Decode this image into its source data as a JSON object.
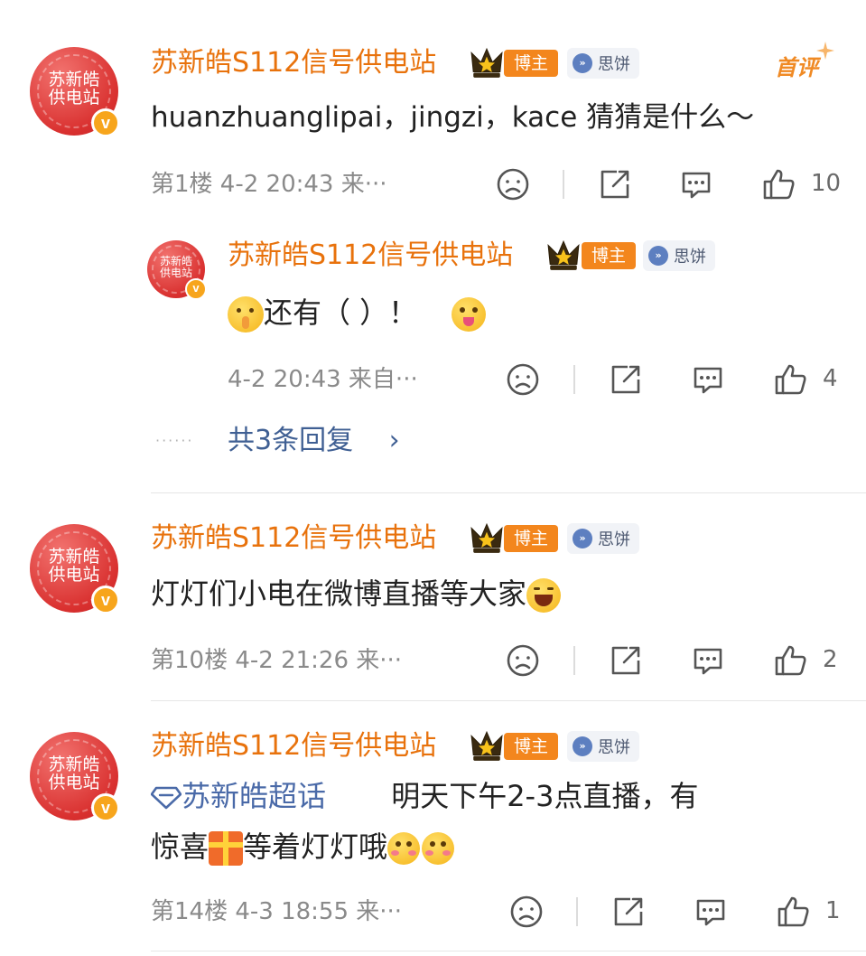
{
  "colors": {
    "username": "#e8720c",
    "bozhu_badge": "#f3861d",
    "link": "#3f5f93",
    "meta": "#8a8a8a"
  },
  "comments": [
    {
      "avatar_text": "苏新皓供电站",
      "username": "苏新皓S112信号供电站",
      "badge": "博主",
      "tag": "思饼",
      "hot_label": "首评",
      "text": "huanzhuanglipai，jingzi，kace 猜猜是什么～",
      "meta": "第1楼 4-2 20:43 来···",
      "likes": "10",
      "reply": {
        "avatar_text": "苏新皓供电站",
        "username": "苏新皓S112信号供电站",
        "badge": "博主",
        "tag": "思饼",
        "text": "还有（ ）！",
        "meta": "4-2 20:43 来自···",
        "likes": "4"
      },
      "more_replies": "共3条回复"
    },
    {
      "avatar_text": "苏新皓供电站",
      "username": "苏新皓S112信号供电站",
      "badge": "博主",
      "tag": "思饼",
      "text": "灯灯们小电在微博直播等大家",
      "meta": "第10楼 4-2 21:26 来···",
      "likes": "2"
    },
    {
      "avatar_text": "苏新皓供电站",
      "username": "苏新皓S112信号供电站",
      "badge": "博主",
      "tag": "思饼",
      "topic": "苏新皓超话",
      "text_line1": "明天下午2-3点直播，有",
      "text_line2": "惊喜",
      "text_line2b": "等着灯灯哦",
      "meta": "第14楼 4-3 18:55 来···",
      "likes": "1"
    }
  ]
}
